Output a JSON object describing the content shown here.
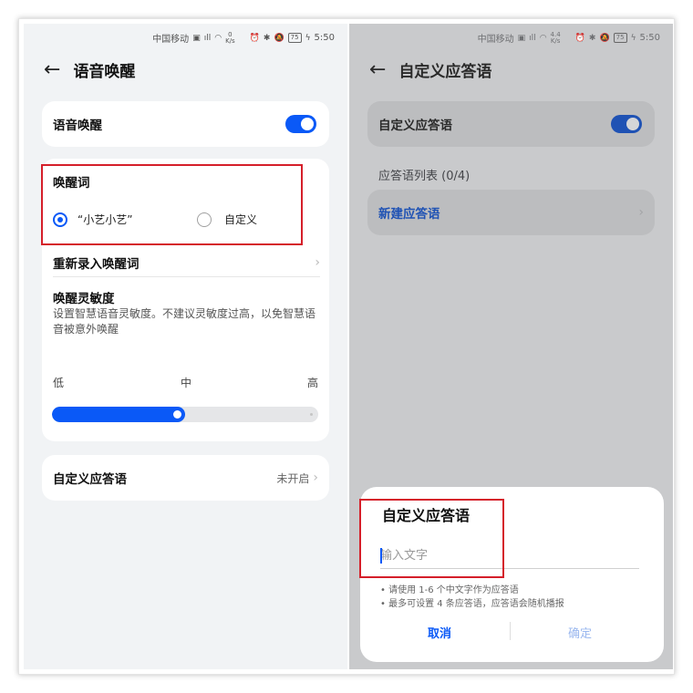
{
  "left": {
    "status": {
      "carrier": "中国移动",
      "net_speed": "0",
      "net_unit": "K/s",
      "battery": "75",
      "time": "5:50"
    },
    "title": "语音唤醒",
    "voice_wakeup": {
      "label": "语音唤醒",
      "enabled": true
    },
    "wake_word": {
      "label": "唤醒词",
      "options": [
        {
          "label": "“小艺小艺”",
          "selected": true
        },
        {
          "label": "自定义",
          "selected": false
        }
      ]
    },
    "rerecord": {
      "label": "重新录入唤醒词"
    },
    "sensitivity": {
      "title": "唤醒灵敏度",
      "desc": "设置智慧语音灵敏度。不建议灵敏度过高，以免智慧语音被意外唤醒",
      "low": "低",
      "mid": "中",
      "high": "高",
      "value_fraction": 0.5
    },
    "custom_reply": {
      "label": "自定义应答语",
      "value": "未开启"
    }
  },
  "right": {
    "status": {
      "carrier": "中国移动",
      "net_speed": "4.4",
      "net_unit": "K/s",
      "battery": "75",
      "time": "5:50"
    },
    "title": "自定义应答语",
    "custom_reply_toggle": {
      "label": "自定义应答语",
      "enabled": true
    },
    "list_header": "应答语列表 (0/4)",
    "new_reply": {
      "label": "新建应答语"
    },
    "sheet": {
      "title": "自定义应答语",
      "placeholder": "输入文字",
      "tip1": "• 请使用 1-6 个中文字作为应答语",
      "tip2": "• 最多可设置 4 条应答语，应答语会随机播报",
      "cancel": "取消",
      "confirm": "确定"
    }
  },
  "colors": {
    "accent": "#0a59f7",
    "highlight_box": "#d51f2a"
  }
}
